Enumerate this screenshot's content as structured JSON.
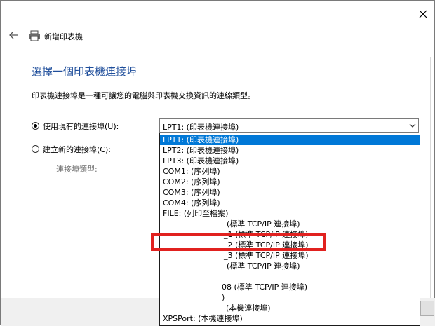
{
  "window": {
    "title": "新增印表機"
  },
  "page": {
    "heading": "選擇一個印表機連接埠",
    "description": "印表機連接埠是一種可讓您的電腦與印表機交換資訊的連線類型。"
  },
  "options": {
    "use_existing_label": "使用現有的連接埠(U):",
    "use_existing_selected": true,
    "create_new_label": "建立新的連接埠(C):",
    "create_new_selected": false,
    "port_type_label": "連接埠類型:"
  },
  "combo": {
    "value": "LPT1: (印表機連接埠)"
  },
  "dropdown": {
    "items": [
      {
        "text": "LPT1: (印表機連接埠)",
        "selected": true
      },
      {
        "text": "LPT2: (印表機連接埠)",
        "selected": false
      },
      {
        "text": "LPT3: (印表機連接埠)",
        "selected": false
      },
      {
        "text": "COM1: (序列埠)",
        "selected": false
      },
      {
        "text": "COM2: (序列埠)",
        "selected": false
      },
      {
        "text": "COM3: (序列埠)",
        "selected": false
      },
      {
        "text": "COM4: (序列埠)",
        "selected": false
      },
      {
        "text": "FILE: (列印至檔案)",
        "selected": false
      },
      {
        "text": "(標準 TCP/IP 連接埠)",
        "selected": false
      },
      {
        "text": "_1 (標準 TCP/IP 連接埠)",
        "selected": false
      },
      {
        "text": "_2 (標準 TCP/IP 連接埠)",
        "selected": false
      },
      {
        "text": "_3 (標準 TCP/IP 連接埠)",
        "selected": false
      },
      {
        "text": "(標準 TCP/IP 連接埠)",
        "selected": false
      },
      {
        "text": "",
        "selected": false
      },
      {
        "text": "08 (標準 TCP/IP 連接埠)",
        "selected": false
      },
      {
        "text": ")",
        "selected": false
      },
      {
        "text": "(本機連接埠)",
        "selected": false
      },
      {
        "text": "XPSPort: (本機連接埠)",
        "selected": false
      }
    ]
  },
  "annotation": {
    "color": "#e1211f"
  }
}
